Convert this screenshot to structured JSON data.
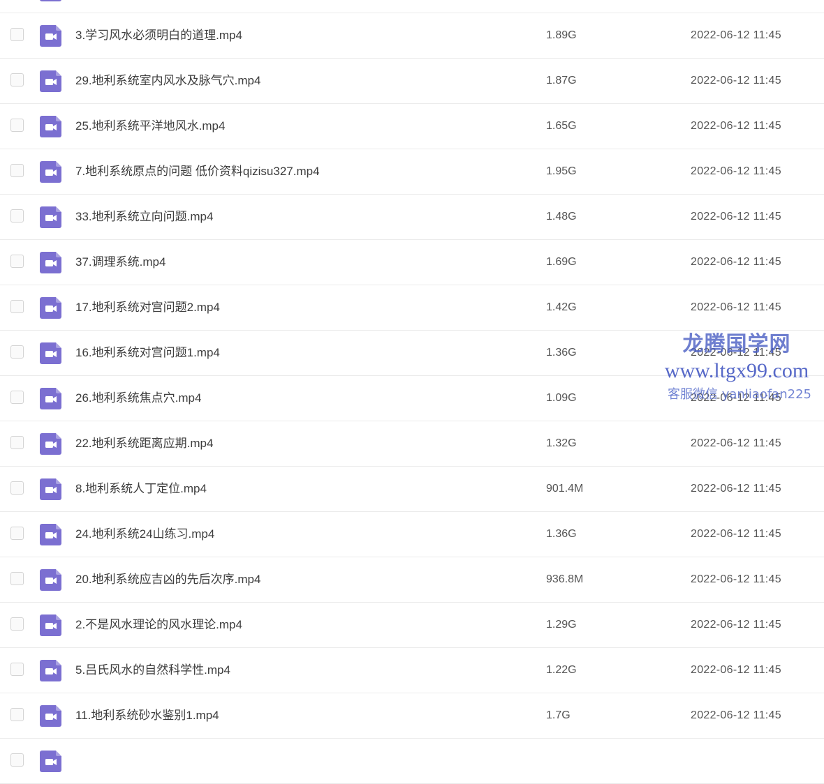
{
  "colors": {
    "video_icon": "#7b6fd1",
    "watermark": "#4a5fc4"
  },
  "icons": {
    "file": "video-file-icon",
    "checkbox": "checkbox"
  },
  "files": [
    {
      "name": "",
      "size": "",
      "date": ""
    },
    {
      "name": "3.学习风水必须明白的道理.mp4",
      "size": "1.89G",
      "date": "2022-06-12 11:45"
    },
    {
      "name": "29.地利系统室内风水及脉气穴.mp4",
      "size": "1.87G",
      "date": "2022-06-12 11:45"
    },
    {
      "name": "25.地利系统平洋地风水.mp4",
      "size": "1.65G",
      "date": "2022-06-12 11:45"
    },
    {
      "name": "7.地利系统原点的问题 低价资料qizisu327.mp4",
      "size": "1.95G",
      "date": "2022-06-12 11:45"
    },
    {
      "name": "33.地利系统立向问题.mp4",
      "size": "1.48G",
      "date": "2022-06-12 11:45"
    },
    {
      "name": "37.调理系统.mp4",
      "size": "1.69G",
      "date": "2022-06-12 11:45"
    },
    {
      "name": "17.地利系统对宫问题2.mp4",
      "size": "1.42G",
      "date": "2022-06-12 11:45"
    },
    {
      "name": "16.地利系统对宫问题1.mp4",
      "size": "1.36G",
      "date": "2022-06-12 11:45"
    },
    {
      "name": "26.地利系统焦点穴.mp4",
      "size": "1.09G",
      "date": "2022-06-12 11:45"
    },
    {
      "name": "22.地利系统距离应期.mp4",
      "size": "1.32G",
      "date": "2022-06-12 11:45"
    },
    {
      "name": "8.地利系统人丁定位.mp4",
      "size": "901.4M",
      "date": "2022-06-12 11:45"
    },
    {
      "name": "24.地利系统24山练习.mp4",
      "size": "1.36G",
      "date": "2022-06-12 11:45"
    },
    {
      "name": "20.地利系统应吉凶的先后次序.mp4",
      "size": "936.8M",
      "date": "2022-06-12 11:45"
    },
    {
      "name": "2.不是风水理论的风水理论.mp4",
      "size": "1.29G",
      "date": "2022-06-12 11:45"
    },
    {
      "name": "5.吕氏风水的自然科学性.mp4",
      "size": "1.22G",
      "date": "2022-06-12 11:45"
    },
    {
      "name": "11.地利系统砂水鉴别1.mp4",
      "size": "1.7G",
      "date": "2022-06-12 11:45"
    },
    {
      "name": "",
      "size": "",
      "date": ""
    }
  ],
  "watermark": {
    "title": "龙腾国学网",
    "url": "www.ltgx99.com",
    "contact": "客服微信 yanliaofan225"
  }
}
